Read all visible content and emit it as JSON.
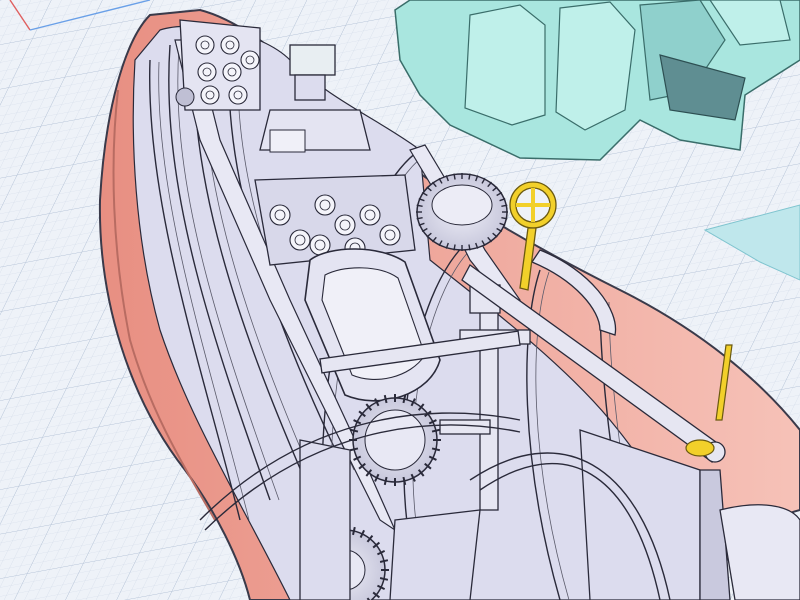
{
  "viewport": {
    "kind": "3d-cad-viewport",
    "background_color": "#eef2f8",
    "grid_color": "#c9d4e3",
    "grid_major_color": "#b3c1d6",
    "axis_x_color": "#e06060",
    "axis_y_color": "#6aa0e8"
  },
  "model": {
    "fuselage_shell_color": "#f0a89a",
    "fuselage_shell_edge": "#3a3a4a",
    "frame_color": "#dcdcee",
    "frame_edge": "#2a2a3a",
    "seat_color": "#e4e4f2",
    "gear_color": "#d6d6e6",
    "handwheel_color": "#f2d02a",
    "canopy_color": "#a9e6df",
    "canopy_edge": "#3a6d6a",
    "canopy_interior_color": "#7fb6b6",
    "wing_plane_color": "#bfe7ec"
  },
  "icons": {
    "handwheel": "yellow-handwheel-icon",
    "lever": "yellow-lever-icon"
  }
}
